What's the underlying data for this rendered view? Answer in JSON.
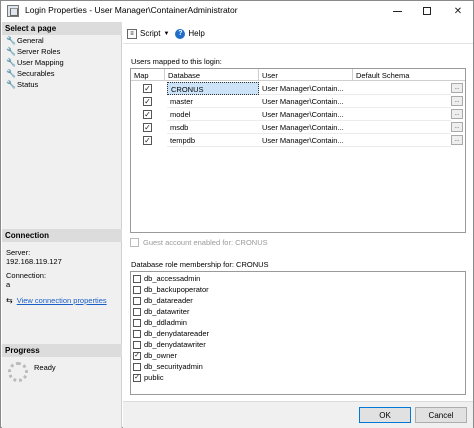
{
  "window": {
    "title": "Login Properties - User Manager\\ContainerAdministrator",
    "minimize": "–",
    "maximize": "",
    "close": "✕"
  },
  "left": {
    "select_page_heading": "Select a page",
    "pages": [
      {
        "label": "General",
        "icon": "wrench-icon"
      },
      {
        "label": "Server Roles",
        "icon": "wrench-icon"
      },
      {
        "label": "User Mapping",
        "icon": "wrench-icon"
      },
      {
        "label": "Securables",
        "icon": "wrench-icon"
      },
      {
        "label": "Status",
        "icon": "wrench-icon"
      }
    ],
    "connection_heading": "Connection",
    "server_label": "Server:",
    "server_value": "192.168.119.127",
    "connection_label": "Connection:",
    "connection_value": "a",
    "view_link": "View connection properties",
    "progress_heading": "Progress",
    "progress_status": "Ready"
  },
  "toolbar": {
    "script_label": "Script",
    "help_label": "Help"
  },
  "users_mapped": {
    "label": "Users mapped to this login:",
    "columns": [
      "Map",
      "Database",
      "User",
      "Default Schema"
    ],
    "rows": [
      {
        "mapped": true,
        "database": "CRONUS",
        "user": "User Manager\\Contain...",
        "schema": "",
        "selected": true
      },
      {
        "mapped": true,
        "database": "master",
        "user": "User Manager\\Contain...",
        "schema": "",
        "selected": false
      },
      {
        "mapped": true,
        "database": "model",
        "user": "User Manager\\Contain...",
        "schema": "",
        "selected": false
      },
      {
        "mapped": true,
        "database": "msdb",
        "user": "User Manager\\Contain...",
        "schema": "",
        "selected": false
      },
      {
        "mapped": true,
        "database": "tempdb",
        "user": "User Manager\\Contain...",
        "schema": "",
        "selected": false
      }
    ],
    "ellipsis": "..."
  },
  "guest": {
    "label": "Guest account enabled for: CRONUS",
    "checked": false
  },
  "roles": {
    "label": "Database role membership for: CRONUS",
    "items": [
      {
        "name": "db_accessadmin",
        "checked": false
      },
      {
        "name": "db_backupoperator",
        "checked": false
      },
      {
        "name": "db_datareader",
        "checked": false
      },
      {
        "name": "db_datawriter",
        "checked": false
      },
      {
        "name": "db_ddladmin",
        "checked": false
      },
      {
        "name": "db_denydatareader",
        "checked": false
      },
      {
        "name": "db_denydatawriter",
        "checked": false
      },
      {
        "name": "db_owner",
        "checked": true
      },
      {
        "name": "db_securityadmin",
        "checked": false
      },
      {
        "name": "public",
        "checked": true
      }
    ]
  },
  "footer": {
    "ok_label": "OK",
    "cancel_label": "Cancel"
  },
  "colors": {
    "selection": "#cde3f8",
    "link": "#1a5ec9",
    "help_icon": "#1f6fc9",
    "ok_border": "#0078d7"
  }
}
